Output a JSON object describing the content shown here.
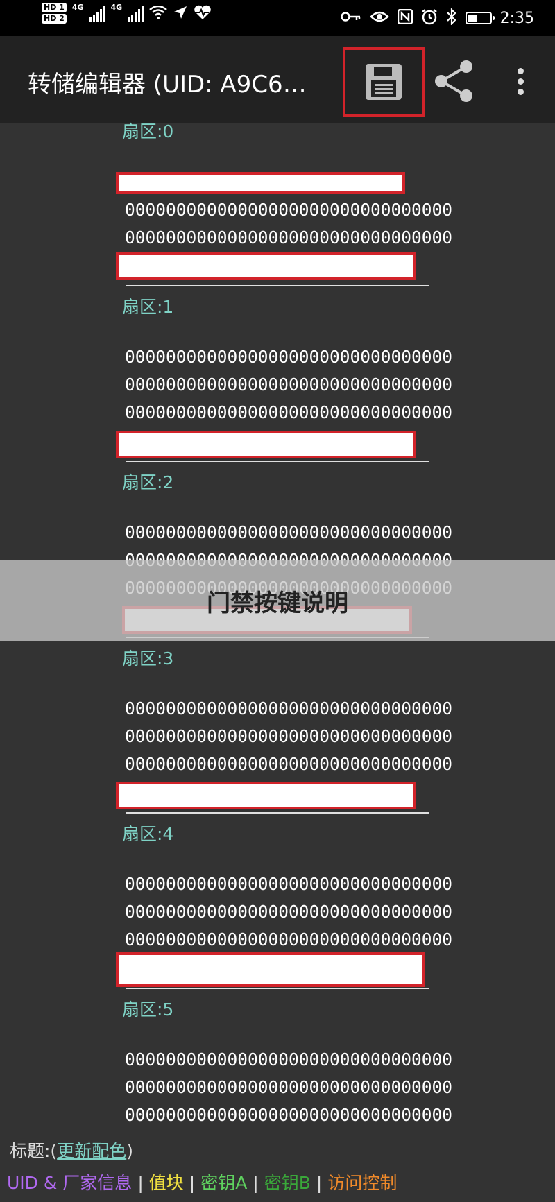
{
  "status_bar": {
    "hd1": "HD 1",
    "hd2": "HD 2",
    "net1": "4G",
    "net2": "4G",
    "time": "2:35"
  },
  "app_bar": {
    "title": "转储编辑器 (UID: A9C6…",
    "save_icon": "floppy-disk-icon",
    "share_icon": "share-icon",
    "more_icon": "more-vert-icon"
  },
  "sectors": [
    {
      "label": "扇区:0",
      "lines": [
        "00000000000000000000000000000000",
        "00000000000000000000000000000000"
      ]
    },
    {
      "label": "扇区:1",
      "lines": [
        "00000000000000000000000000000000",
        "00000000000000000000000000000000",
        "00000000000000000000000000000000"
      ]
    },
    {
      "label": "扇区:2",
      "lines": [
        "00000000000000000000000000000000",
        "00000000000000000000000000000000",
        "00000000000000000000000000000000"
      ]
    },
    {
      "label": "扇区:3",
      "lines": [
        "00000000000000000000000000000000",
        "00000000000000000000000000000000",
        "00000000000000000000000000000000"
      ]
    },
    {
      "label": "扇区:4",
      "lines": [
        "00000000000000000000000000000000",
        "00000000000000000000000000000000",
        "00000000000000000000000000000000"
      ]
    },
    {
      "label": "扇区:5",
      "lines": [
        "00000000000000000000000000000000",
        "00000000000000000000000000000000",
        "00000000000000000000000000000000"
      ]
    }
  ],
  "banner": {
    "text": "门禁按键说明"
  },
  "legend": {
    "title_prefix": "标题:(",
    "title_link": "更新配色",
    "title_suffix": ")",
    "items": [
      {
        "label": "UID & 厂家信息",
        "color": "#b069f0"
      },
      {
        "label": "值块",
        "color": "#f0e040"
      },
      {
        "label": "密钥A",
        "color": "#5fd35f"
      },
      {
        "label": "密钥B",
        "color": "#3aa83a"
      },
      {
        "label": "访问控制",
        "color": "#f08a2a"
      }
    ]
  },
  "colors": {
    "accent_red": "#d2232a",
    "sector_label": "#7fd3c6",
    "background": "#333333"
  }
}
